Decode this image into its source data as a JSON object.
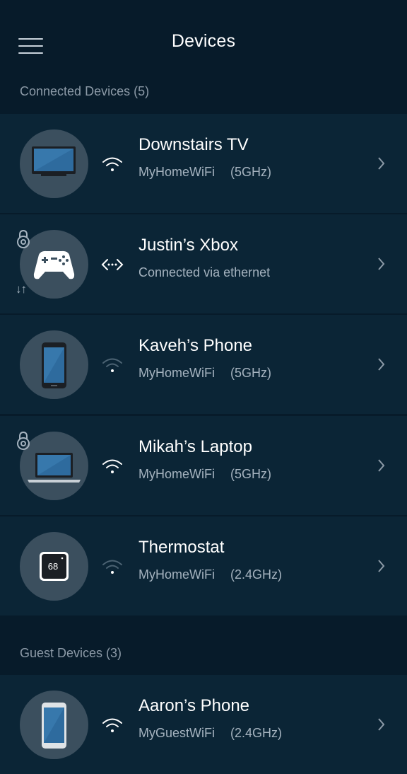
{
  "header": {
    "title": "Devices",
    "menu_icon": "hamburger-menu-icon"
  },
  "connected": {
    "label": "Connected Devices (5)",
    "devices": [
      {
        "name": "Downstairs TV",
        "network": "MyHomeWiFi",
        "band": "(5GHz)",
        "icon": "tv-icon",
        "connection": "wifi-strong"
      },
      {
        "name": "Justin’s Xbox",
        "network": "Connected via ethernet",
        "band": "",
        "icon": "gamepad-icon",
        "connection": "ethernet",
        "locked": true,
        "activity": "↓↑"
      },
      {
        "name": "Kaveh’s Phone",
        "network": "MyHomeWiFi",
        "band": "(5GHz)",
        "icon": "phone-icon",
        "connection": "wifi-weak"
      },
      {
        "name": "Mikah’s Laptop",
        "network": "MyHomeWiFi",
        "band": "(5GHz)",
        "icon": "laptop-icon",
        "connection": "wifi-strong",
        "locked": true
      },
      {
        "name": "Thermostat",
        "network": "MyHomeWiFi",
        "band": "(2.4GHz)",
        "icon": "thermostat-icon",
        "connection": "wifi-weak",
        "display": "68"
      }
    ]
  },
  "guest": {
    "label": "Guest Devices  (3)",
    "devices": [
      {
        "name": "Aaron’s Phone",
        "network": "MyGuestWiFi",
        "band": "(2.4GHz)",
        "icon": "phone-icon",
        "connection": "wifi-strong"
      }
    ]
  },
  "colors": {
    "background": "#071b2a",
    "row": "#0b2536",
    "avatar": "#3b4f5e",
    "secondary_text": "#a5b3bf",
    "section_text": "#8c9aa7"
  }
}
